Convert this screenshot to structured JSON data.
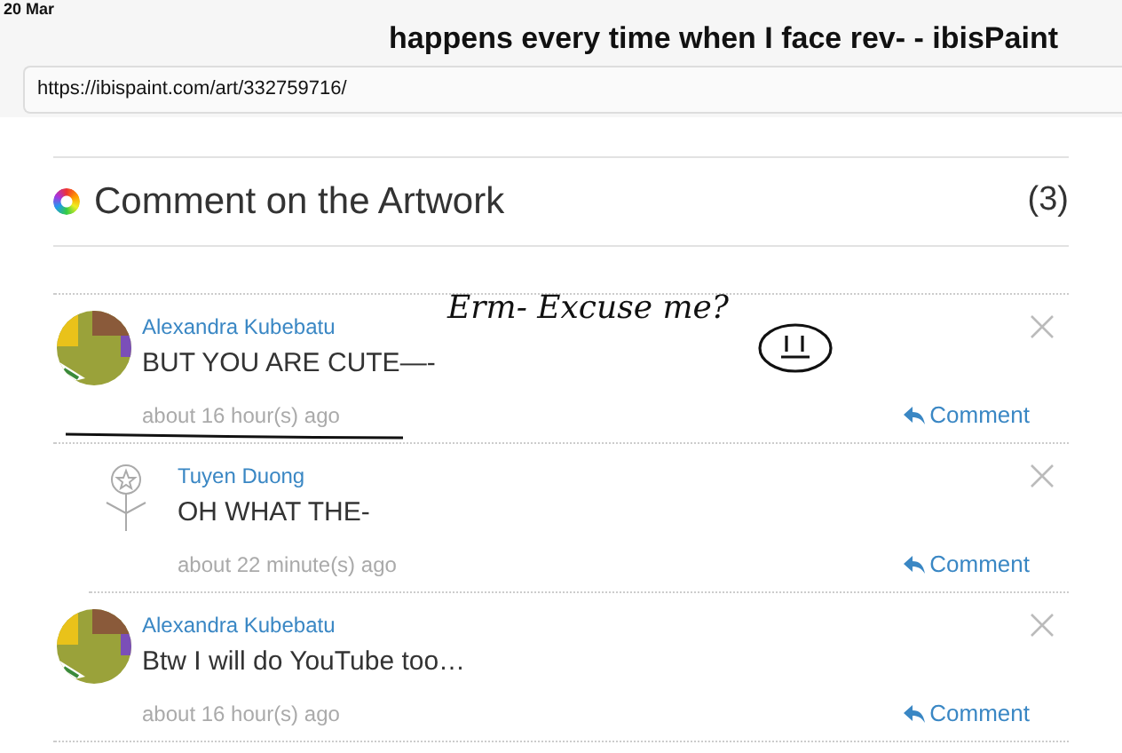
{
  "status_bar": {
    "date": "20 Mar"
  },
  "browser": {
    "title": "happens every time when I face rev- - ibisPaint",
    "url": "https://ibispaint.com/art/332759716/"
  },
  "section": {
    "heading": "Comment on the Artwork",
    "count": "(3)"
  },
  "comments": [
    {
      "author": "Alexandra Kubebatu",
      "text": "BUT YOU ARE CUTE—-",
      "time": "about 16 hour(s) ago",
      "action": "Comment",
      "children": [
        {
          "author": "Tuyen Duong",
          "text": "OH WHAT THE-",
          "time": "about 22 minute(s) ago",
          "action": "Comment"
        }
      ]
    },
    {
      "author": "Alexandra Kubebatu",
      "text": "Btw I will do YouTube too…",
      "time": "about 16 hour(s) ago",
      "action": "Comment"
    }
  ],
  "annotation": {
    "text": "Erm- Excuse me?"
  }
}
